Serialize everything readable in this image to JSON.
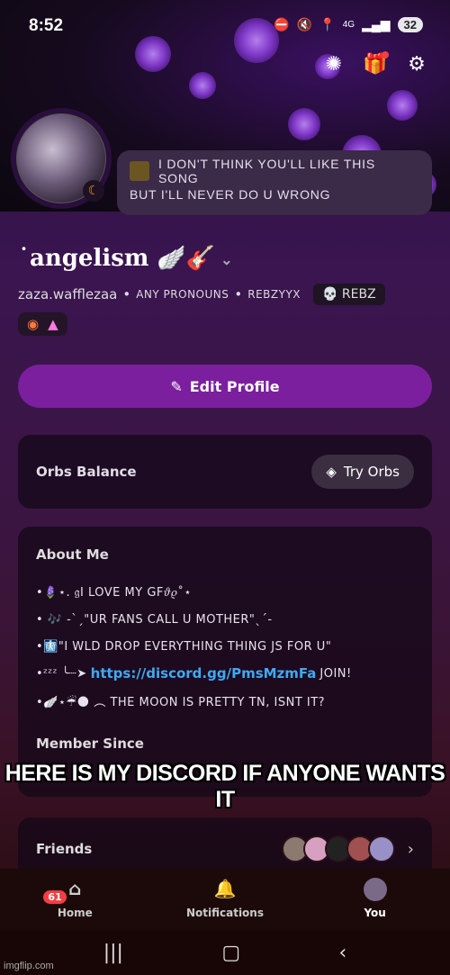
{
  "statusbar": {
    "time": "8:52",
    "network": "4G",
    "battery": "32"
  },
  "status_message": {
    "line1": "I DON'T THINK YOU'LL LIKE THIS SONG",
    "line2": "BUT I'LL NEVER DO U WRONG"
  },
  "profile": {
    "display_name": "˙angelism 🪽🎸",
    "username": "zaza.wafflezaa",
    "pronouns": "ANY PRONOUNS",
    "alt_handle": "REBZYYX",
    "guild_tag": "REBZ"
  },
  "edit_profile_label": "Edit Profile",
  "orbs": {
    "label": "Orbs Balance",
    "button": "Try Orbs"
  },
  "about": {
    "title": "About Me",
    "lines": [
      "•🪻⋆. 𝔤I LOVE MY GF𝜗𝜚˚⋆",
      "• 🎶 -ˋˏ\"UR FANS CALL U MOTHER\"ˎˊ-",
      "•🩻\"I WLD DROP EVERYTHING THING JS FOR U\"",
      "JOIN!",
      "•🪽⋆☔🌑 ︵ THE MOON IS PRETTY TN, ISNT IT?"
    ],
    "link_prefix": "•ᶻᶻᶻ ╰┈➤",
    "link": "https://discord.gg/PmsMzmFa"
  },
  "member_since_title": "Member Since",
  "caption": "HERE IS MY DISCORD IF ANYONE WANTS IT",
  "friends_title": "Friends",
  "nav": {
    "home": "Home",
    "home_badge": "61",
    "notifications": "Notifications",
    "you": "You"
  },
  "watermark": "imgflip.com",
  "colors": {
    "accent": "#7b1f9e",
    "link": "#3fa9f5",
    "badge": "#f23f43"
  }
}
